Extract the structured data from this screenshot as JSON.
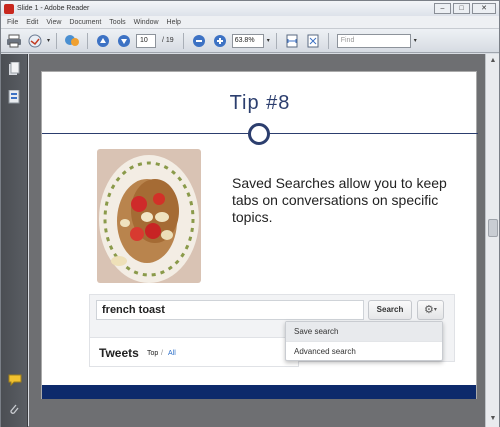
{
  "window": {
    "title": "Slide 1 - Adobe Reader",
    "minimize": "–",
    "maximize": "□",
    "close": "✕"
  },
  "menu": {
    "items": [
      "File",
      "Edit",
      "View",
      "Document",
      "Tools",
      "Window",
      "Help"
    ]
  },
  "toolbar": {
    "page_current": "10",
    "page_total": "/ 19",
    "zoom": "63.8%",
    "find_placeholder": "Find"
  },
  "slide": {
    "title": "Tip #8",
    "body": "Saved Searches allow you to keep tabs on conversations on specific topics.",
    "search_value": "french toast",
    "search_button": "Search",
    "gear_label": "⚙",
    "gear_caret": "▾",
    "tweets_label": "Tweets",
    "tweets_top": "Top",
    "tweets_sep": "/",
    "tweets_all": "All",
    "dropdown": [
      "Save search",
      "Advanced search"
    ]
  },
  "colors": {
    "accent": "#2c3e6e",
    "band": "#0d2a6b",
    "link": "#2c6fc9"
  }
}
